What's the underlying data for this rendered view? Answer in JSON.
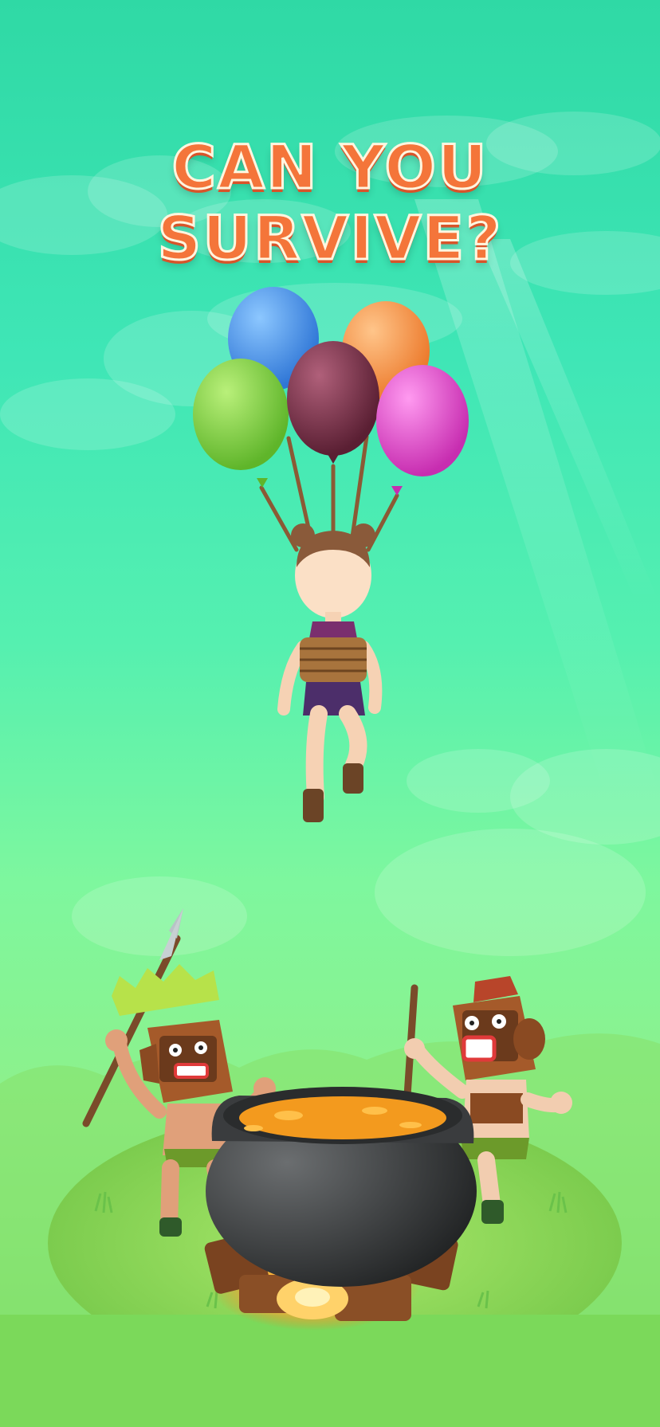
{
  "headline": "CAN YOU SURVIVE?",
  "colors": {
    "headline": "#f4753a",
    "sky_top": "#2fd9a5",
    "grass": "#7ddd6a",
    "soup": "#f39a1e",
    "pot": "#3a3c3e"
  },
  "balloons": [
    {
      "name": "blue-balloon",
      "color": "#3f8fe6"
    },
    {
      "name": "orange-balloon",
      "color": "#f68b3e"
    },
    {
      "name": "green-balloon",
      "color": "#7fcf3a"
    },
    {
      "name": "maroon-balloon",
      "color": "#7a3048"
    },
    {
      "name": "pink-balloon",
      "color": "#e046c8"
    }
  ],
  "characters": {
    "captive": "girl-tied-with-rope",
    "left_native": "tribal-mask-with-spear",
    "right_native": "tribal-mask-with-stirring-stick"
  }
}
